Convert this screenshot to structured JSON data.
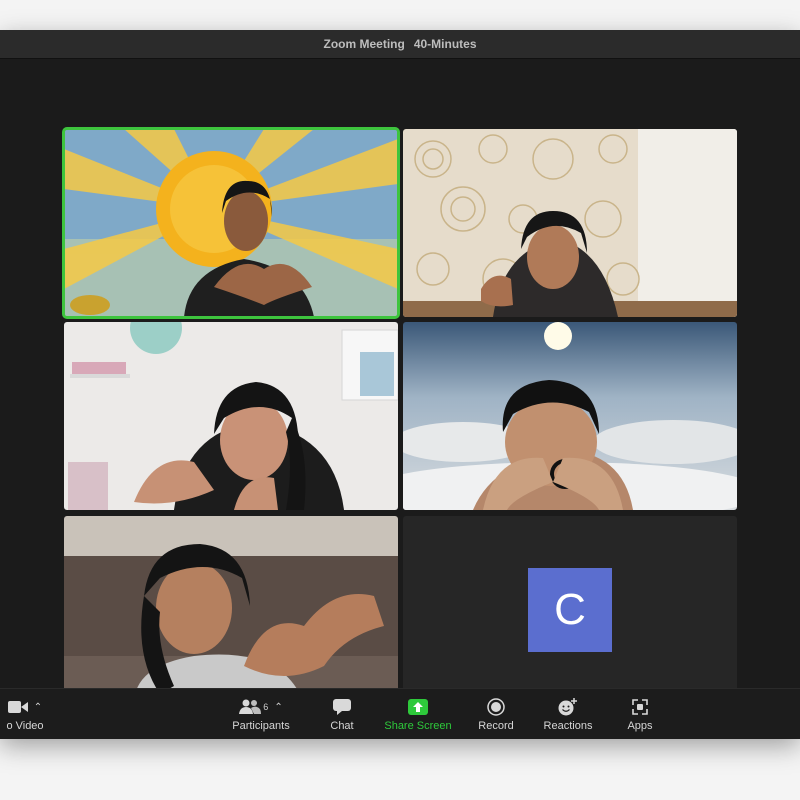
{
  "window": {
    "title": "Zoom Meeting",
    "subtitle": "40-Minutes"
  },
  "tiles": [
    {
      "name": "participant-tile-1",
      "active_speaker": true,
      "background": "sun-virtual-background"
    },
    {
      "name": "participant-tile-2",
      "active_speaker": false,
      "background": "patterned-wallpaper"
    },
    {
      "name": "participant-tile-3",
      "active_speaker": false,
      "background": "white-room"
    },
    {
      "name": "participant-tile-4",
      "active_speaker": false,
      "background": "clouds-virtual-background"
    },
    {
      "name": "participant-tile-5",
      "active_speaker": false,
      "background": "sofa-room"
    },
    {
      "name": "participant-tile-6",
      "active_speaker": false,
      "avatar_letter": "C"
    }
  ],
  "toolbar": {
    "video_label": "o Video",
    "participants_label": "Participants",
    "participants_count": "6",
    "chat_label": "Chat",
    "share_label": "Share Screen",
    "record_label": "Record",
    "reactions_label": "Reactions",
    "apps_label": "Apps"
  },
  "colors": {
    "active_speaker_border": "#3ec43e",
    "share_screen": "#2ec93b",
    "avatar_bg": "#5b6ecf"
  }
}
